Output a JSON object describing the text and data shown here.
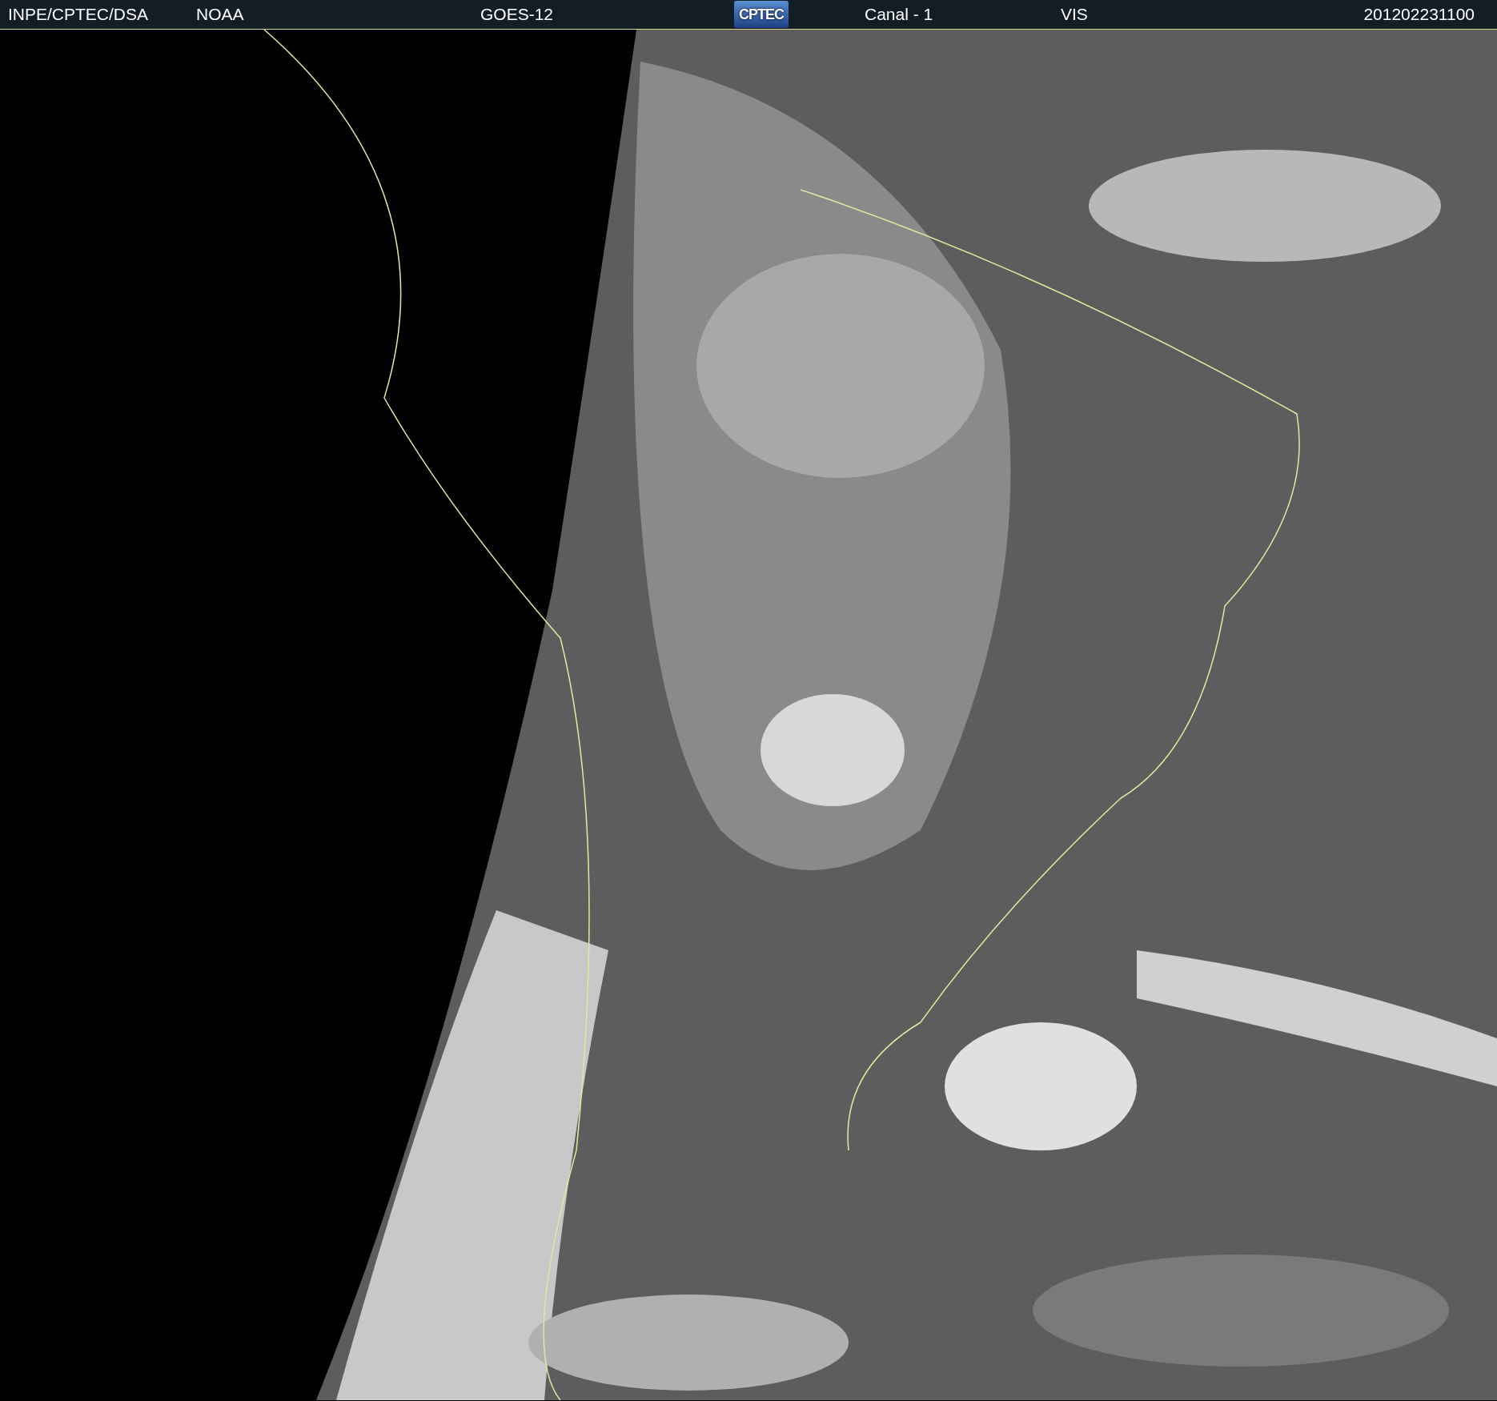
{
  "header": {
    "source": "INPE/CPTEC/DSA",
    "agency": "NOAA",
    "satellite": "GOES-12",
    "logo": "CPTEC",
    "channel": "Canal - 1",
    "band": "VIS",
    "timestamp": "201202231100"
  }
}
